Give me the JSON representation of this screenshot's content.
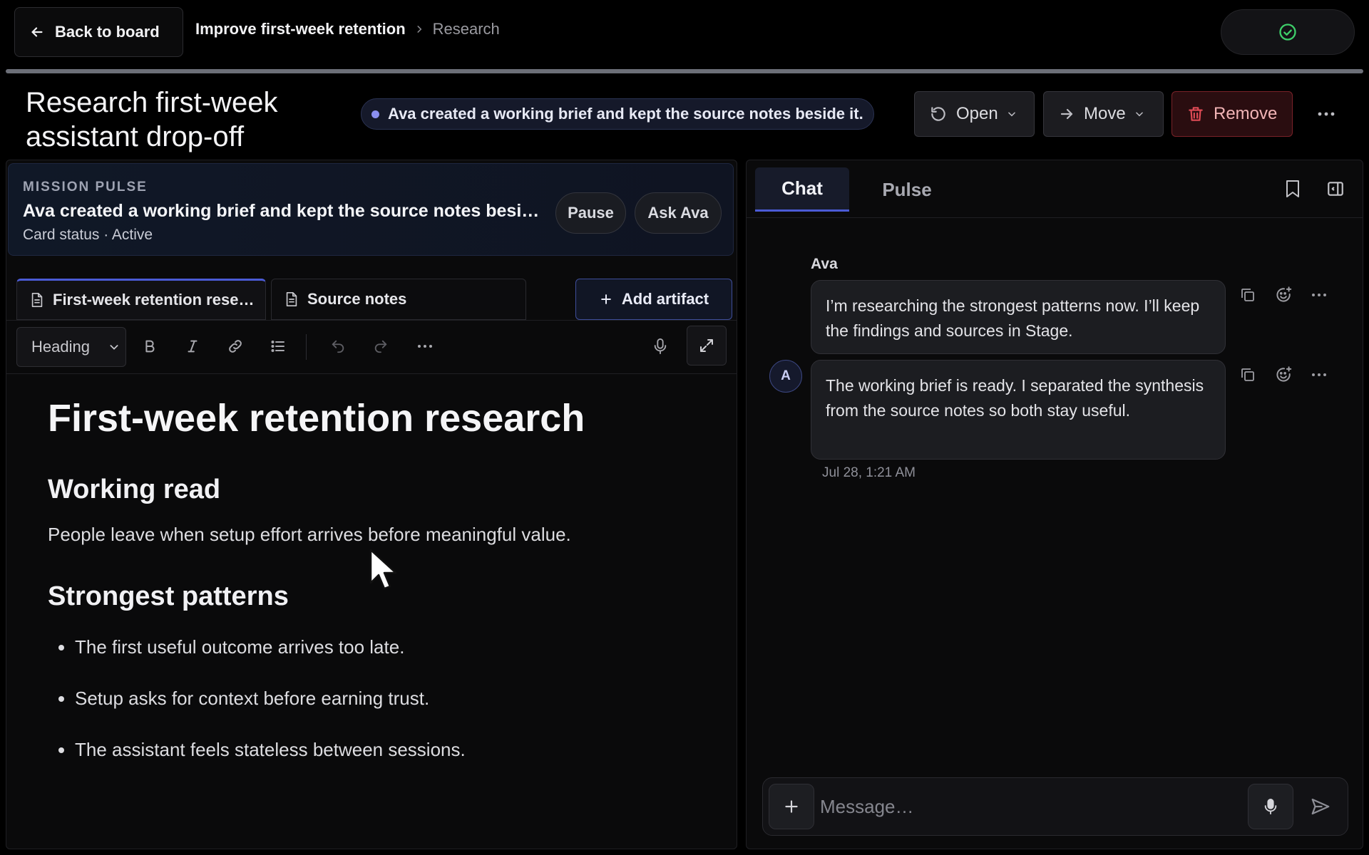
{
  "topbar": {
    "back_label": "Back to board",
    "breadcrumb_main": "Improve first-week retention",
    "breadcrumb_sub": "Research",
    "status_icon": "check-circle-icon",
    "status_color": "#3ecf6a"
  },
  "header": {
    "title": "Research first-week assistant drop-off",
    "activity_text": "Ava created a working brief and kept the source notes beside it.",
    "open_label": "Open",
    "move_label": "Move",
    "remove_label": "Remove",
    "accent_color": "#4b5bd6",
    "danger_color": "#e04b55"
  },
  "mission_pulse": {
    "eyebrow": "MISSION PULSE",
    "title": "Ava created a working brief and kept the source notes beside it.",
    "status": "Card status · Active",
    "pause_label": "Pause",
    "ask_label": "Ask Ava"
  },
  "artifacts": {
    "tabs": [
      {
        "label": "First-week retention research",
        "icon": "document-icon"
      },
      {
        "label": "Source notes",
        "icon": "document-icon"
      }
    ],
    "add_label": "Add artifact"
  },
  "editor": {
    "block_type": "Heading",
    "tools": [
      "bold-icon",
      "italic-icon",
      "link-icon",
      "list-icon",
      "undo-icon",
      "redo-icon",
      "more-icon",
      "mic-icon",
      "expand-icon"
    ]
  },
  "document": {
    "h1": "First-week retention research",
    "sections": [
      {
        "heading": "Working read",
        "paragraph": "People leave when setup effort arrives before meaningful value."
      }
    ],
    "patterns_heading": "Strongest patterns",
    "patterns": [
      "The first useful outcome arrives too late.",
      "Setup asks for context before earning trust.",
      "The assistant feels stateless between sessions."
    ]
  },
  "chat": {
    "tabs": [
      "Chat",
      "Pulse"
    ],
    "sender": "Ava",
    "avatar_initial": "A",
    "messages": [
      {
        "text": "I’m researching the strongest patterns now. I’ll keep the findings and sources in Stage."
      },
      {
        "text": "The working brief is ready. I separated the synthesis from the source notes so both stay useful."
      }
    ],
    "timestamp": "Jul 28, 1:21 AM",
    "composer_placeholder": "Message…"
  }
}
